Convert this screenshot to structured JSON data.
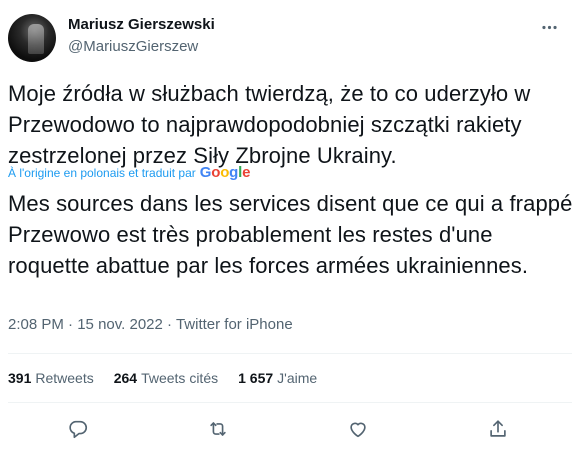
{
  "author": {
    "name": "Mariusz Gierszewski",
    "handle": "@MariuszGierszew"
  },
  "tweet": {
    "text_original": "Moje źródła w służbach twierdzą, że to co uderzyło w Przewodowo to najprawdopodobniej szczątki rakiety zestrzelonej przez Siły Zbrojne Ukrainy.",
    "translation_note": "À l'origine en polonais et traduit par",
    "translation_provider": "Google",
    "text_translated": "Mes sources dans les services disent que ce qui a frappé Przewowo est très probablement les restes d'une roquette abattue par les forces armées ukrainiennes.",
    "time": "2:08 PM",
    "date": "15 nov. 2022",
    "source": "Twitter for iPhone"
  },
  "stats": {
    "retweets_count": "391",
    "retweets_label": "Retweets",
    "quotes_count": "264",
    "quotes_label": "Tweets cités",
    "likes_count": "1 657",
    "likes_label": "J'aime"
  },
  "icons": {
    "more": "more-horizontal-icon",
    "reply": "reply-icon",
    "retweet": "retweet-icon",
    "like": "heart-icon",
    "share": "share-icon"
  },
  "colors": {
    "link": "#1d9bf0",
    "secondary_text": "#536471",
    "primary_text": "#0f1419"
  }
}
